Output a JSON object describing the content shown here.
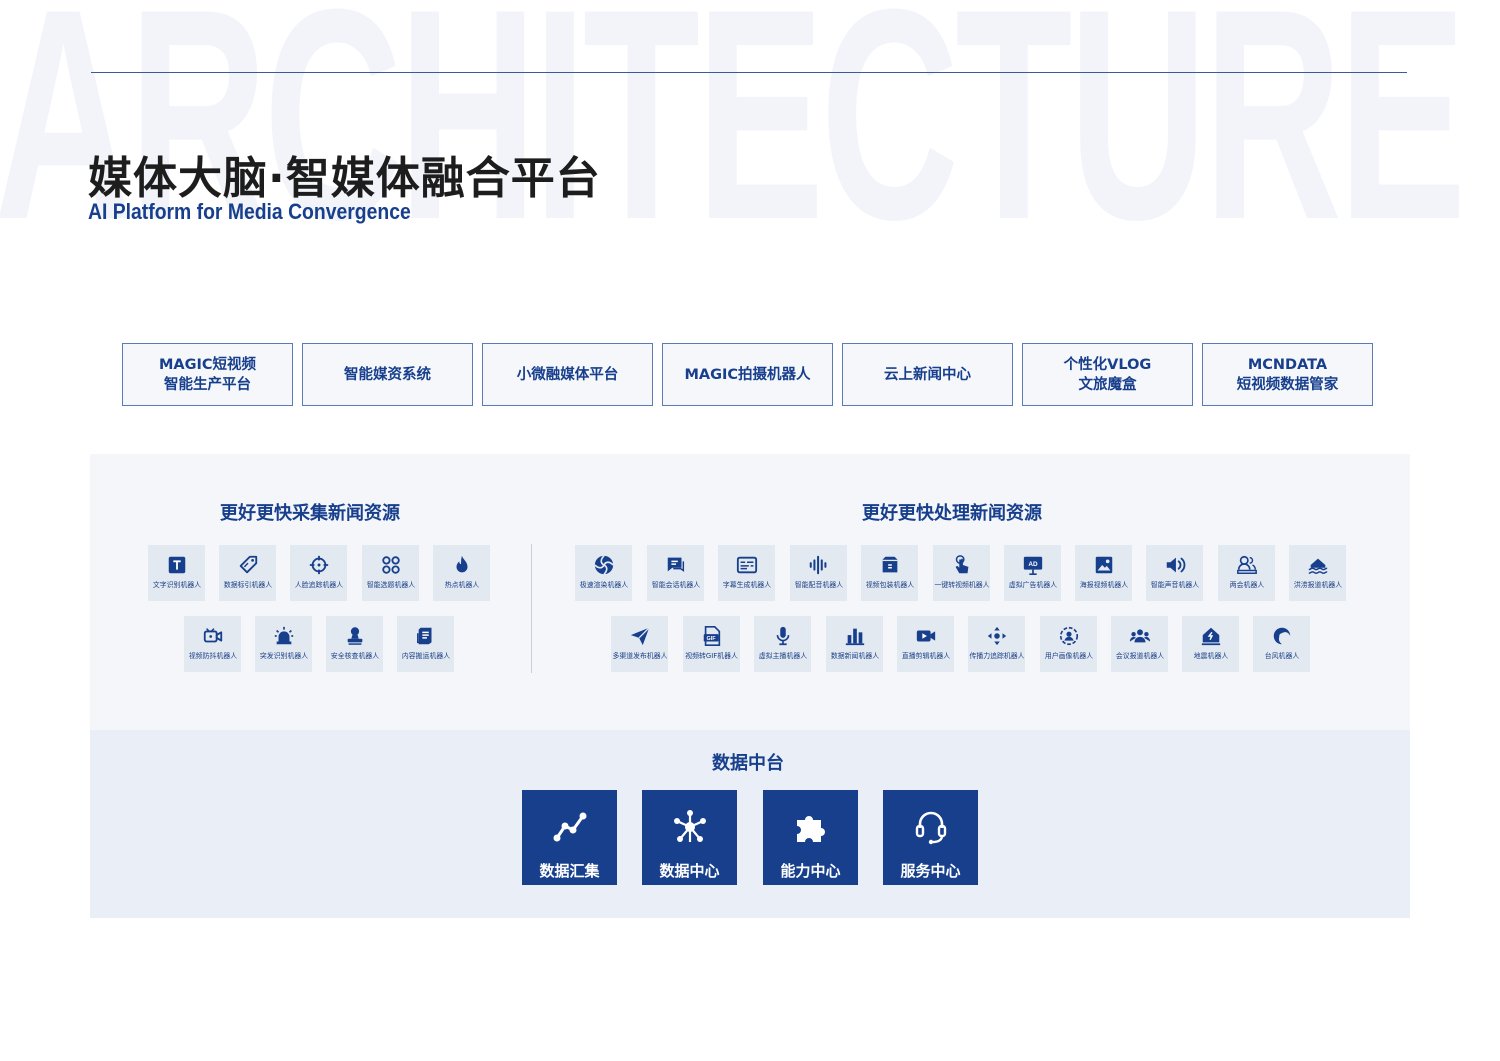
{
  "header": {
    "watermark": "ARCHITECTURE",
    "title": "媒体大脑·智媒体融合平台",
    "subtitle": "AI Platform for Media Convergence"
  },
  "platforms": [
    {
      "label": "MAGIC短视频\n智能生产平台"
    },
    {
      "label": "智能媒资系统"
    },
    {
      "label": "小微融媒体平台"
    },
    {
      "label": "MAGIC拍摄机器人"
    },
    {
      "label": "云上新闻中心"
    },
    {
      "label": "个性化VLOG\n文旅魔盒"
    },
    {
      "label": "MCNDATA\n短视频数据管家"
    }
  ],
  "collect": {
    "title": "更好更快采集新闻资源",
    "robots": [
      {
        "label": "文字识别机器人",
        "icon": "text-icon"
      },
      {
        "label": "数据标引机器人",
        "icon": "tag-icon"
      },
      {
        "label": "人脸追踪机器人",
        "icon": "crosshair-icon"
      },
      {
        "label": "智能选题机器人",
        "icon": "apps-icon"
      },
      {
        "label": "热点机器人",
        "icon": "flame-icon"
      },
      {
        "label": "视频防抖机器人",
        "icon": "video-camera-icon"
      },
      {
        "label": "突发识别机器人",
        "icon": "alarm-light-icon"
      },
      {
        "label": "安全核查机器人",
        "icon": "stamp-icon"
      },
      {
        "label": "内容搬运机器人",
        "icon": "document-transfer-icon"
      }
    ]
  },
  "process": {
    "title": "更好更快处理新闻资源",
    "robots": [
      {
        "label": "极速渲染机器人",
        "icon": "aperture-icon"
      },
      {
        "label": "智能会话机器人",
        "icon": "chat-icon"
      },
      {
        "label": "字幕生成机器人",
        "icon": "subtitles-icon"
      },
      {
        "label": "智能配音机器人",
        "icon": "sound-wave-icon"
      },
      {
        "label": "视频包装机器人",
        "icon": "package-icon"
      },
      {
        "label": "一键转视频机器人",
        "icon": "tap-icon"
      },
      {
        "label": "虚拟广告机器人",
        "icon": "ad-board-icon"
      },
      {
        "label": "海报视频机器人",
        "icon": "image-icon"
      },
      {
        "label": "智能声音机器人",
        "icon": "speaker-icon"
      },
      {
        "label": "两会机器人",
        "icon": "meeting-icon"
      },
      {
        "label": "洪涝报道机器人",
        "icon": "flood-icon"
      },
      {
        "label": "多渠道发布机器人",
        "icon": "paper-plane-icon"
      },
      {
        "label": "视频转GIF机器人",
        "icon": "gif-file-icon"
      },
      {
        "label": "虚拟主播机器人",
        "icon": "microphone-icon"
      },
      {
        "label": "数据新闻机器人",
        "icon": "bar-chart-icon"
      },
      {
        "label": "直播剪辑机器人",
        "icon": "video-play-icon"
      },
      {
        "label": "传播力追踪机器人",
        "icon": "spread-icon"
      },
      {
        "label": "用户画像机器人",
        "icon": "user-profile-icon"
      },
      {
        "label": "会议报道机器人",
        "icon": "group-icon"
      },
      {
        "label": "地震机器人",
        "icon": "earthquake-icon"
      },
      {
        "label": "台风机器人",
        "icon": "typhoon-icon"
      }
    ]
  },
  "data_center": {
    "title": "数据中台",
    "cards": [
      {
        "label": "数据汇集",
        "icon": "data-collect-icon"
      },
      {
        "label": "数据中心",
        "icon": "data-hub-icon"
      },
      {
        "label": "能力中心",
        "icon": "puzzle-icon"
      },
      {
        "label": "服务中心",
        "icon": "headset-icon"
      }
    ]
  },
  "colors": {
    "brand_blue": "#173f8c",
    "tile_bg": "#e2e9f1",
    "panel_bg": "#f4f6fa",
    "data_panel_bg": "#eaeef6"
  }
}
